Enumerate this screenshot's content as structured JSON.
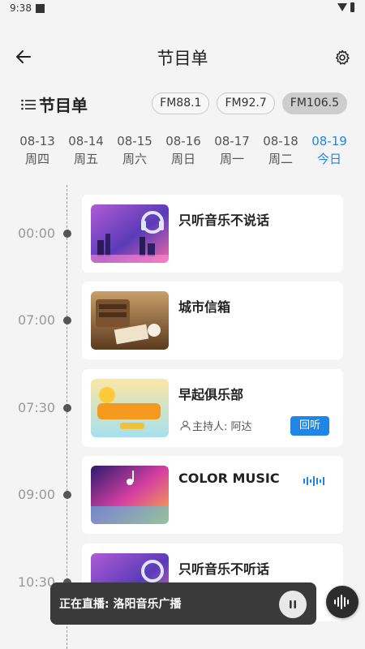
{
  "status_bar": {
    "time": "9:38"
  },
  "header": {
    "title": "节目单"
  },
  "section": {
    "title": "节目单",
    "icon": "list-icon"
  },
  "stations": [
    {
      "label": "FM88.1",
      "selected": false
    },
    {
      "label": "FM92.7",
      "selected": false
    },
    {
      "label": "FM106.5",
      "selected": true
    }
  ],
  "dates": [
    {
      "date": "08-13",
      "weekday": "周四",
      "selected": false
    },
    {
      "date": "08-14",
      "weekday": "周五",
      "selected": false
    },
    {
      "date": "08-15",
      "weekday": "周六",
      "selected": false
    },
    {
      "date": "08-16",
      "weekday": "周日",
      "selected": false
    },
    {
      "date": "08-17",
      "weekday": "周一",
      "selected": false
    },
    {
      "date": "08-18",
      "weekday": "周二",
      "selected": false
    },
    {
      "date": "08-19",
      "weekday": "今日",
      "selected": true
    }
  ],
  "programs": [
    {
      "time": "00:00",
      "name": "只听音乐不说话",
      "thumb_text": "只听音乐不说话"
    },
    {
      "time": "07:00",
      "name": "城市信箱",
      "thumb_text": "城市信箱"
    },
    {
      "time": "07:30",
      "name": "早起俱乐部",
      "thumb_text": "早起俱乐部",
      "host": "主持人: 阿达",
      "action": "回听"
    },
    {
      "time": "09:00",
      "name": "COLOR MUSIC",
      "thumb_text": "color music",
      "live": true
    },
    {
      "time": "10:30",
      "name": "只听音乐不听话",
      "thumb_text": "只听音乐不听话"
    }
  ],
  "now_playing": {
    "text": "正在直播: 洛阳音乐广播"
  },
  "colors": {
    "accent": "#1f86e8",
    "background": "#f4f4f4",
    "player_bar": "#3a3a3a"
  }
}
